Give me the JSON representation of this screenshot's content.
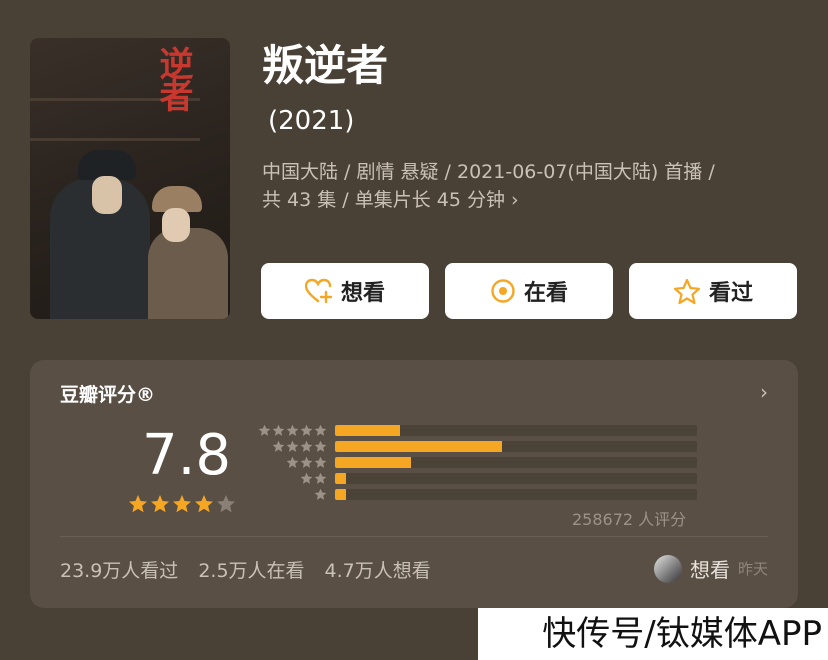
{
  "show": {
    "title": "叛逆者",
    "year": "(2021)",
    "meta_line1": "中国大陆 / 剧情 悬疑 / 2021-06-07(中国大陆) 首播 /",
    "meta_line2": "共 43 集 / 单集片长 45 分钟",
    "meta_chevron": "›",
    "poster_title": "逆者"
  },
  "buttons": [
    {
      "label": "想看",
      "icon": "heart-plus-icon"
    },
    {
      "label": "在看",
      "icon": "target-icon"
    },
    {
      "label": "看过",
      "icon": "star-outline-icon"
    }
  ],
  "rating": {
    "header": "豆瓣评分®",
    "chevron": "›",
    "score": "7.8",
    "star_level": 4,
    "distribution_percent": [
      18,
      46,
      21,
      3,
      3
    ],
    "count_text": "258672 人评分"
  },
  "stats": {
    "watched": "23.9万人看过",
    "watching": "2.5万人在看",
    "want": "4.7万人想看"
  },
  "friend": {
    "action": "想看",
    "time": "昨天"
  },
  "watermark": "快传号/钛媒体APP",
  "colors": {
    "accent": "#f5a623",
    "background": "#4a4136",
    "card": "#594f44"
  }
}
